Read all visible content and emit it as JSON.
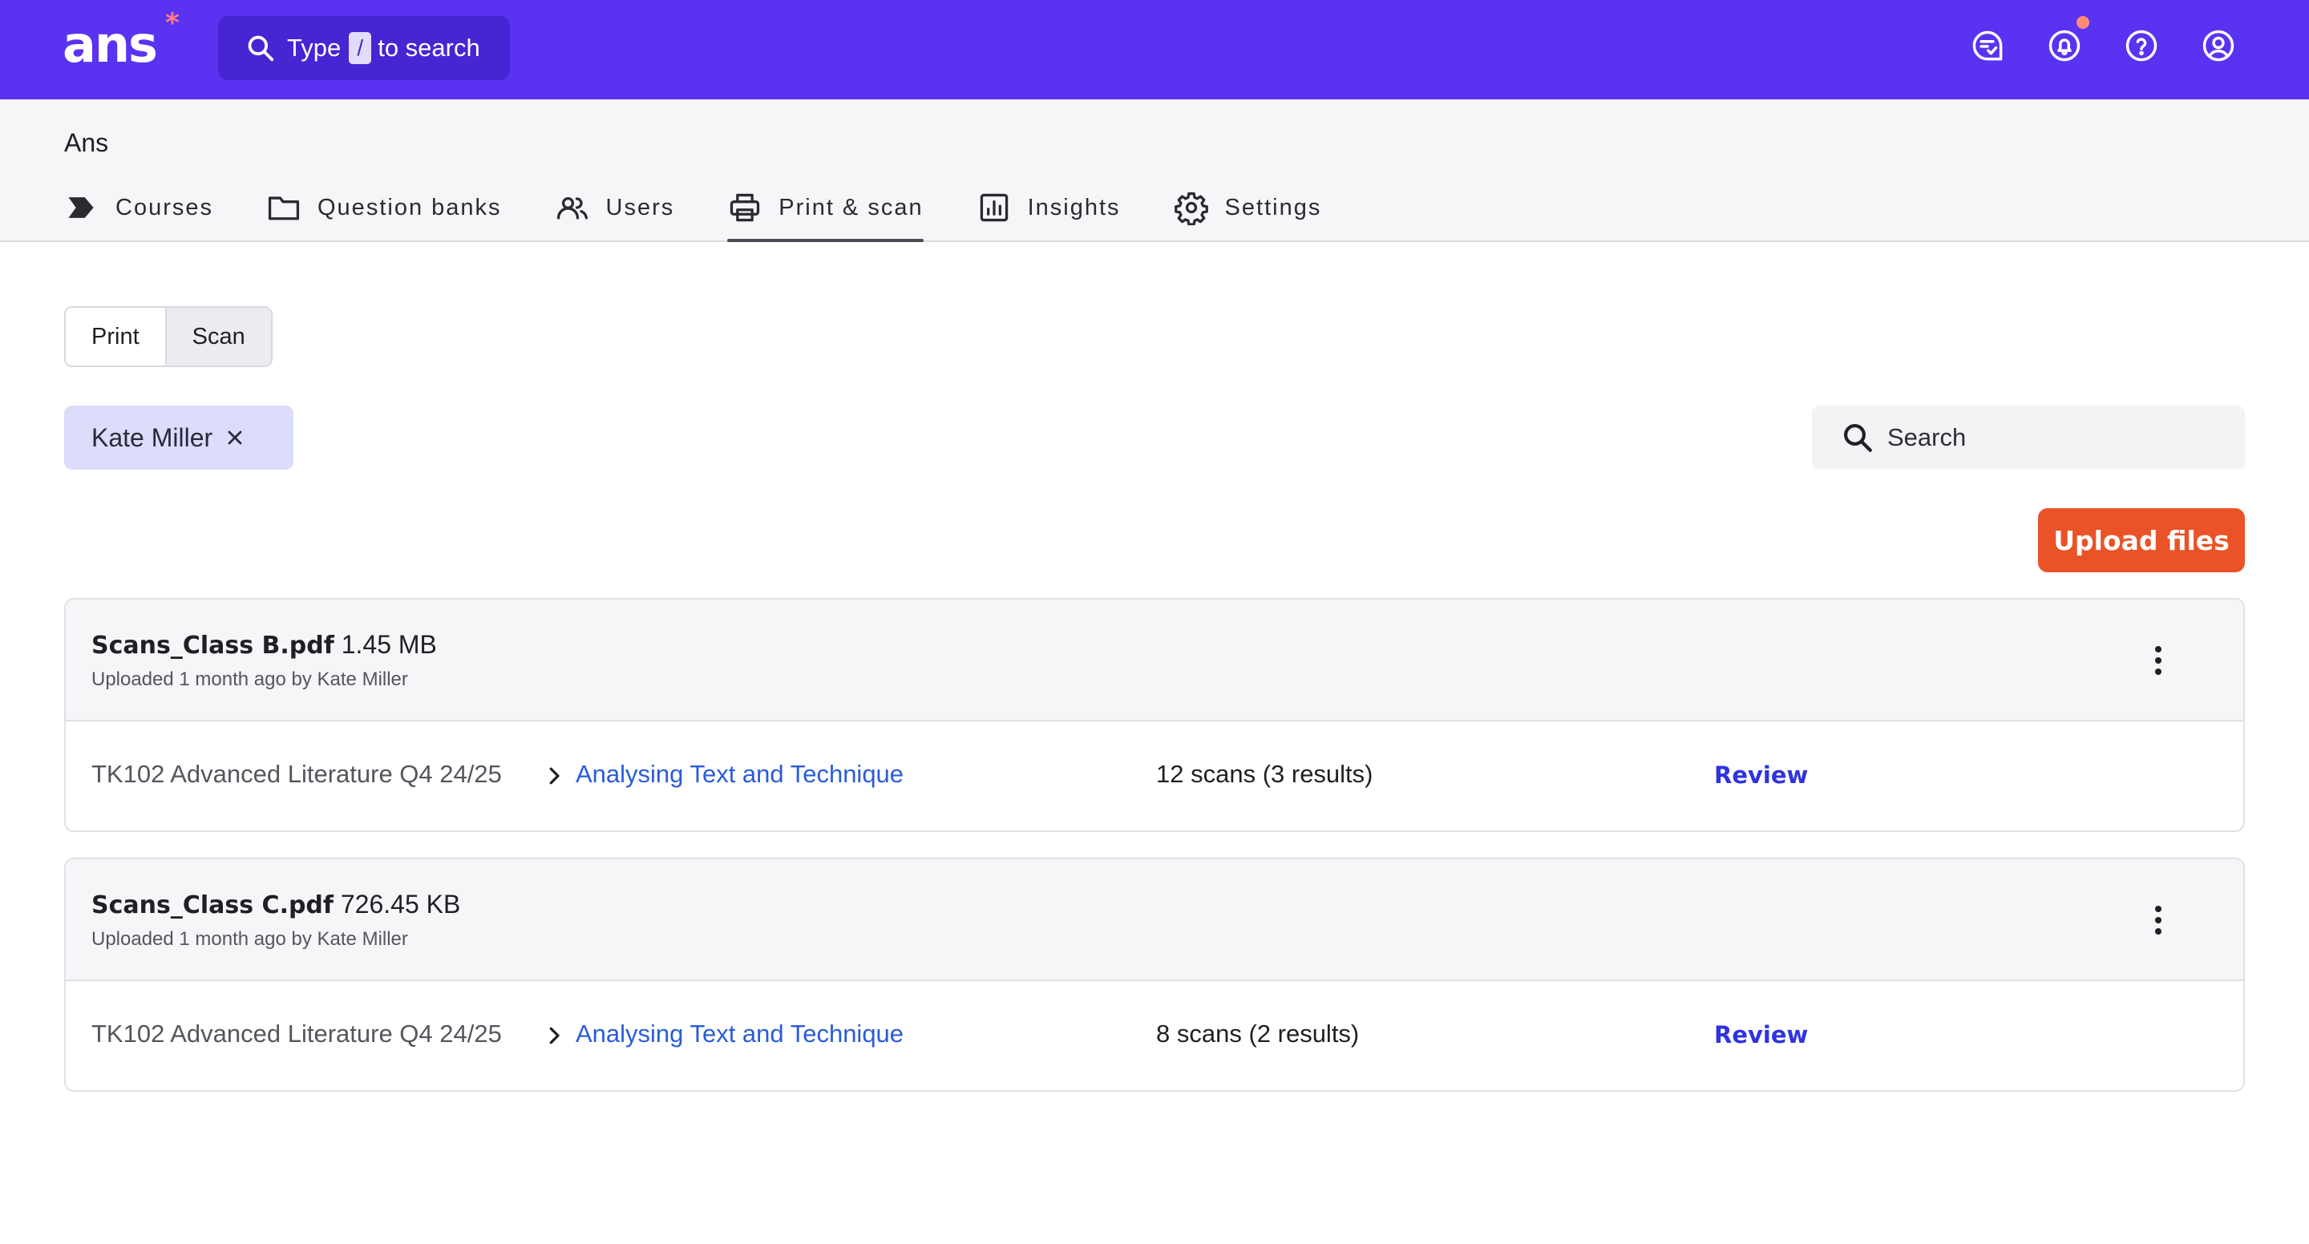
{
  "app": {
    "logo_text": "ans",
    "logo_star": "*",
    "search_prefix": "Type",
    "search_key": "/",
    "search_suffix": "to search",
    "icons": [
      "feedback-icon",
      "bell-icon",
      "help-icon",
      "user-icon"
    ],
    "accent_color": "#5a32f1",
    "notification_dot_color": "#ff8a78"
  },
  "header": {
    "org_name": "Ans",
    "tabs": [
      {
        "label": "Courses",
        "icon": "courses-icon"
      },
      {
        "label": "Question banks",
        "icon": "folder-icon"
      },
      {
        "label": "Users",
        "icon": "users-icon"
      },
      {
        "label": "Print & scan",
        "icon": "printer-icon",
        "active": true
      },
      {
        "label": "Insights",
        "icon": "insights-icon"
      },
      {
        "label": "Settings",
        "icon": "gear-icon"
      }
    ]
  },
  "toggle": {
    "options": [
      "Print",
      "Scan"
    ],
    "selected": "Scan"
  },
  "filter": {
    "chip_label": "Kate Miller"
  },
  "search": {
    "placeholder": "Search"
  },
  "actions": {
    "upload_label": "Upload files",
    "upload_color": "#ea5327"
  },
  "files": [
    {
      "name": "Scans_Class B.pdf",
      "size": "1.45 MB",
      "meta": "Uploaded 1 month ago by Kate Miller",
      "course": "TK102 Advanced Literature Q4 24/25",
      "assignment": "Analysing Text and Technique",
      "scans": "12 scans (3 results)",
      "action": "Review"
    },
    {
      "name": "Scans_Class C.pdf",
      "size": "726.45 KB",
      "meta": "Uploaded 1 month ago by Kate Miller",
      "course": "TK102 Advanced Literature Q4 24/25",
      "assignment": "Analysing Text and Technique",
      "scans": "8 scans (2 results)",
      "action": "Review"
    }
  ]
}
